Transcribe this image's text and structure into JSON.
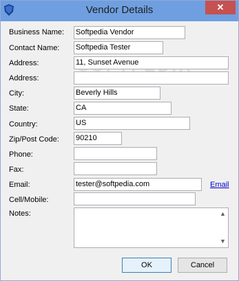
{
  "window": {
    "title": "Vendor Details",
    "close_glyph": "✕"
  },
  "form": {
    "business_name_label": "Business Name:",
    "business_name_value": "Softpedia Vendor",
    "contact_name_label": "Contact Name:",
    "contact_name_value": "Softpedia Tester",
    "address1_label": "Address:",
    "address1_value": "11, Sunset Avenue",
    "address2_label": "Address:",
    "address2_value": "",
    "city_label": "City:",
    "city_value": "Beverly Hills",
    "state_label": "State:",
    "state_value": "CA",
    "country_label": "Country:",
    "country_value": "US",
    "zip_label": "Zip/Post Code:",
    "zip_value": "90210",
    "phone_label": "Phone:",
    "phone_value": "",
    "fax_label": "Fax:",
    "fax_value": "",
    "email_label": "Email:",
    "email_value": "tester@softpedia.com",
    "email_link": "Email",
    "cell_label": "Cell/Mobile:",
    "cell_value": "",
    "notes_label": "Notes:",
    "notes_value": ""
  },
  "buttons": {
    "ok": "OK",
    "cancel": "Cancel"
  },
  "watermark": "SOFTPEDIA"
}
